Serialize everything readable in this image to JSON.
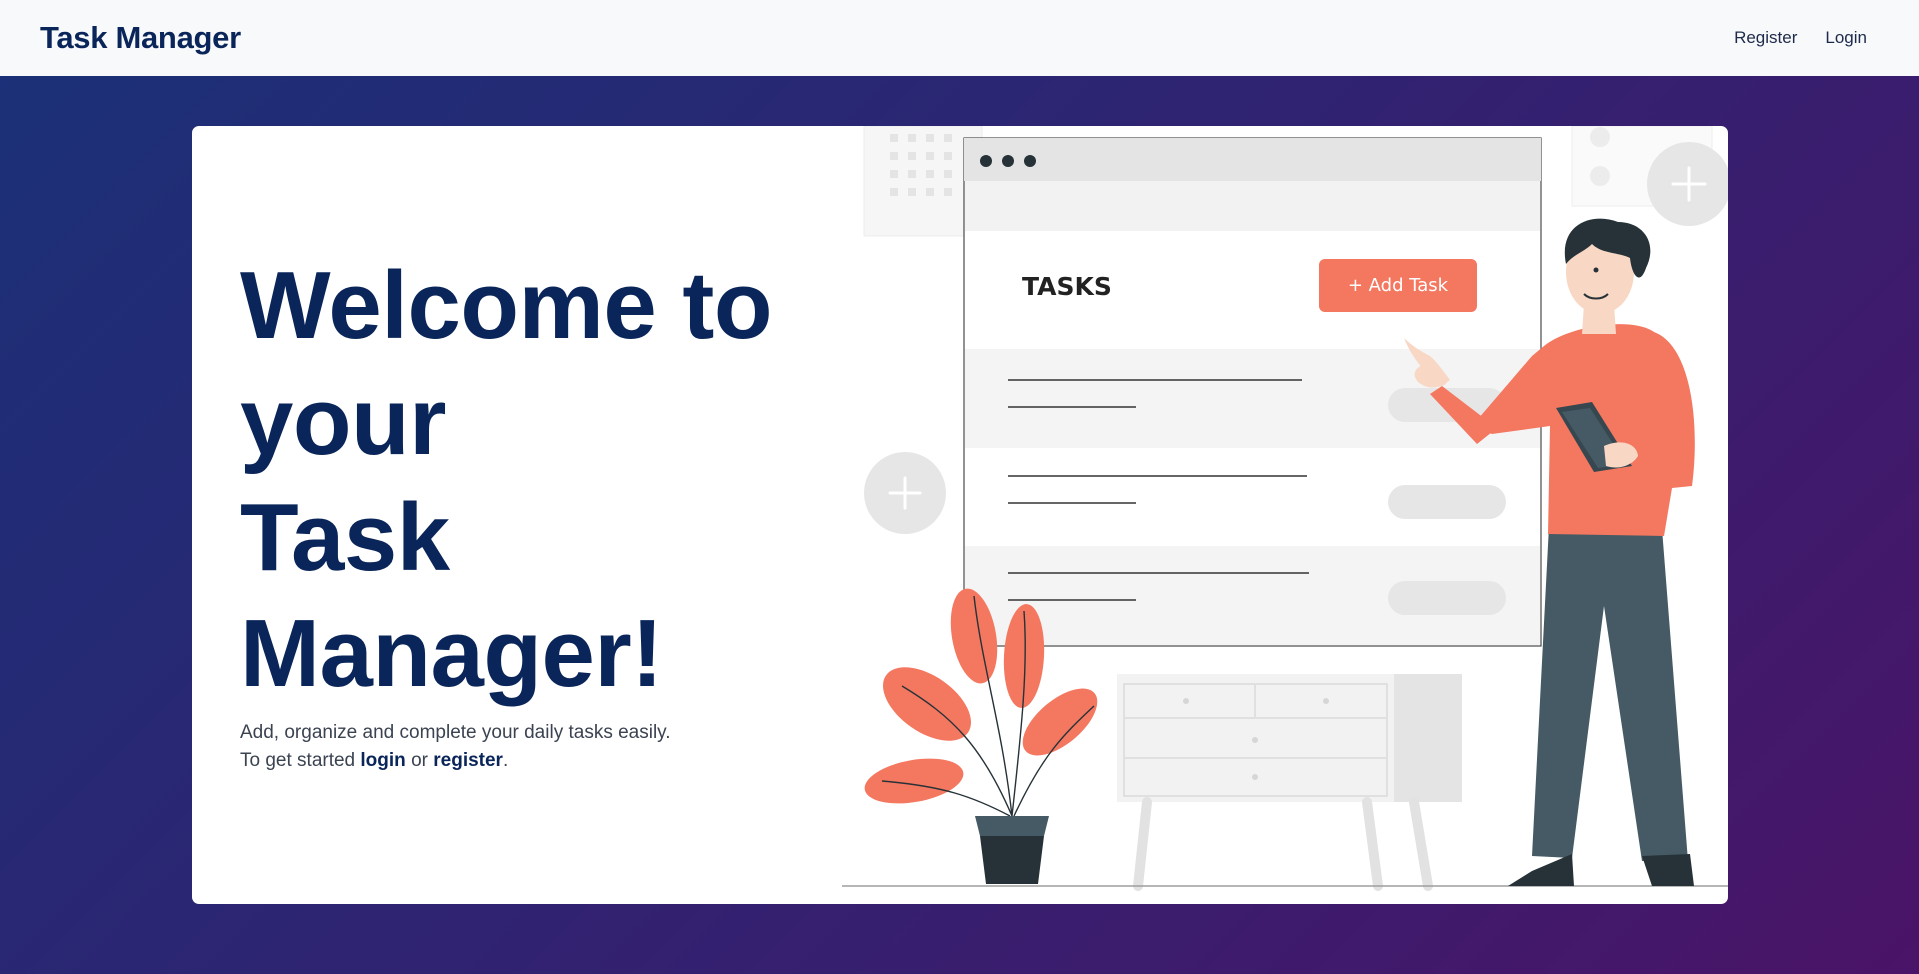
{
  "navbar": {
    "brand": "Task Manager",
    "links": [
      "Register",
      "Login"
    ]
  },
  "hero": {
    "headline_lines": [
      "Welcome to",
      "your",
      "Task",
      "Manager!"
    ],
    "subtitle": "Add, organize and complete your daily tasks easily.",
    "cta_prefix": "To get started ",
    "cta_login": "login",
    "cta_middle": " or ",
    "cta_register": "register",
    "cta_suffix": "."
  },
  "illustration": {
    "tasks_heading": "TASKS",
    "add_task_button": "+ Add Task"
  },
  "colors": {
    "brand_navy": "#0a2559",
    "accent_coral": "#f47760",
    "background_gradient_start": "#1a3178",
    "background_gradient_end": "#4a1468"
  },
  "icons": [
    "plus-circle-icon",
    "window-dots-icon"
  ]
}
